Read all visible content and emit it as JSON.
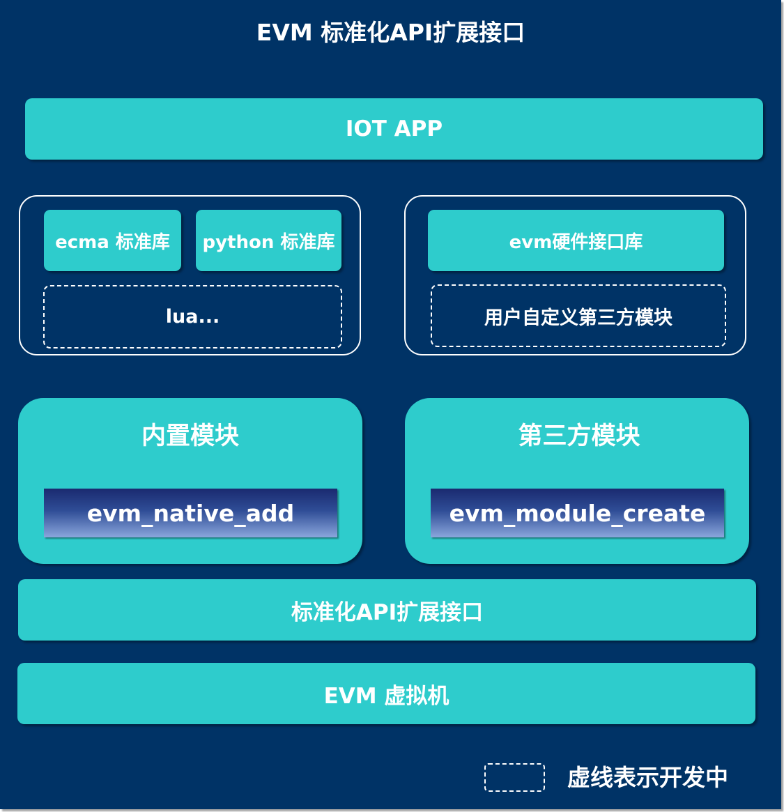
{
  "title": "EVM 标准化API扩展接口",
  "iot_app": "IOT APP",
  "left_group": {
    "libs": [
      "ecma 标准库",
      "python 标准库"
    ],
    "dashed_label": "lua..."
  },
  "right_group": {
    "lib": "evm硬件接口库",
    "dashed_label": "用户自定义第三方模块"
  },
  "builtin_module": {
    "title": "内置模块",
    "api": "evm_native_add"
  },
  "third_party_module": {
    "title": "第三方模块",
    "api": "evm_module_create"
  },
  "standard_api": "标准化API扩展接口",
  "evm_vm": "EVM 虚拟机",
  "legend": {
    "label": "虚线表示开发中"
  },
  "colors": {
    "background": "#003366",
    "teal": "#2ecccc",
    "text": "#ffffff"
  }
}
